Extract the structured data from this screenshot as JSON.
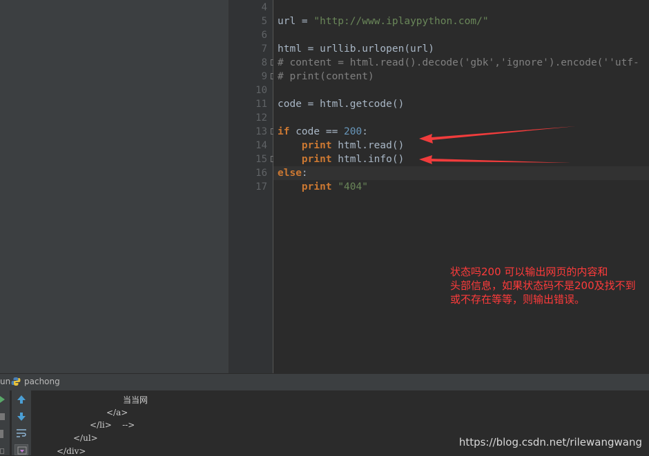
{
  "editor": {
    "line_numbers": [
      "4",
      "5",
      "6",
      "7",
      "8",
      "9",
      "10",
      "11",
      "12",
      "13",
      "14",
      "15",
      "16",
      "17"
    ],
    "lines": [
      {
        "parts": []
      },
      {
        "parts": [
          {
            "t": "url = ",
            "c": ""
          },
          {
            "t": "\"http://www.iplaypython.com/\"",
            "c": "str"
          }
        ]
      },
      {
        "parts": []
      },
      {
        "parts": [
          {
            "t": "html = urllib.urlopen(url)",
            "c": ""
          }
        ]
      },
      {
        "parts": [
          {
            "t": "# content = html.read().decode('gbk','ignore').encode(''utf-",
            "c": "cmt"
          }
        ]
      },
      {
        "parts": [
          {
            "t": "# print(content)",
            "c": "cmt"
          }
        ]
      },
      {
        "parts": []
      },
      {
        "parts": [
          {
            "t": "code = html.getcode()",
            "c": ""
          }
        ]
      },
      {
        "parts": []
      },
      {
        "parts": [
          {
            "t": "if",
            "c": "kw"
          },
          {
            "t": " code == ",
            "c": ""
          },
          {
            "t": "200",
            "c": "num"
          },
          {
            "t": ":",
            "c": ""
          }
        ]
      },
      {
        "parts": [
          {
            "t": "    ",
            "c": ""
          },
          {
            "t": "print",
            "c": "kw"
          },
          {
            "t": " html.read()",
            "c": ""
          }
        ]
      },
      {
        "parts": [
          {
            "t": "    ",
            "c": ""
          },
          {
            "t": "print",
            "c": "kw"
          },
          {
            "t": " html.info()",
            "c": ""
          }
        ]
      },
      {
        "parts": [
          {
            "t": "else",
            "c": "kw"
          },
          {
            "t": ":",
            "c": ""
          }
        ]
      },
      {
        "parts": [
          {
            "t": "    ",
            "c": ""
          },
          {
            "t": "print",
            "c": "kw"
          },
          {
            "t": " ",
            "c": ""
          },
          {
            "t": "\"404\"",
            "c": "str"
          }
        ]
      }
    ]
  },
  "annotation": {
    "line1": "状态吗200 可以输出网页的内容和",
    "line2": "头部信息，如果状态码不是200及找不到",
    "line3": "或不存在等等，则输出错误。"
  },
  "run_panel": {
    "label": "un",
    "config_name": "pachong"
  },
  "console": {
    "lines": [
      "当当网",
      "</a>",
      "</li>    -->",
      "</ul>",
      "</div>"
    ]
  },
  "watermark": "https://blog.csdn.net/rilewangwang",
  "colors": {
    "arrow": "#f03c3c",
    "keyword": "#cc7832",
    "string": "#6a8759",
    "number": "#6897bb",
    "comment": "#808080"
  }
}
